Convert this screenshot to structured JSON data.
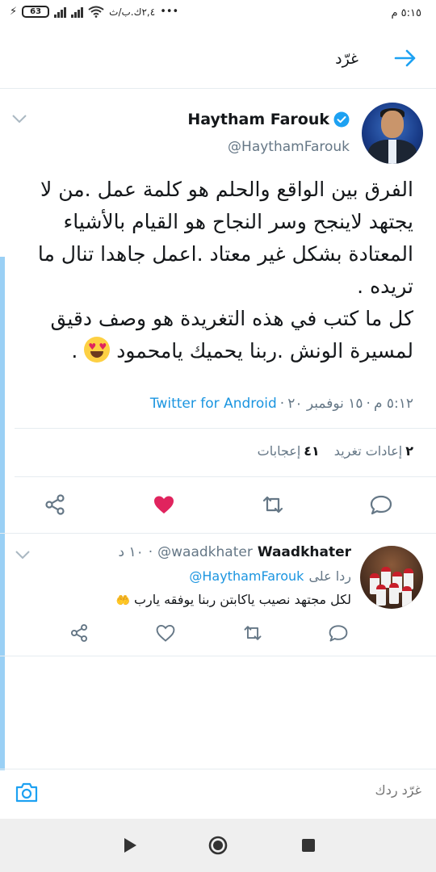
{
  "status_bar": {
    "time": "٥:١٥ م",
    "carrier": "٢,٤ك.ب/ث",
    "battery": "63",
    "dots": "•••"
  },
  "header": {
    "title": "غرّد",
    "back_icon": "arrow-right-icon"
  },
  "tweet": {
    "author_name": "Haytham Farouk",
    "author_handle": "@HaythamFarouk",
    "text": "الفرق بين الواقع والحلم هو كلمة عمل .من لا يجتهد لاينجح وسر النجاح هو القيام بالأشياء المعتادة بشكل غير معتاد .اعمل جاهدا تنال ما تريده .\nكل ما كتب في هذه التغريدة هو وصف دقيق لمسيرة الونش .ربنا يحميك يامحمود",
    "time": "٥:١٢ م",
    "separator": "·",
    "date": "١٥ نوفمبر ٢٠",
    "source": "Twitter for Android",
    "retweets_count": "٢",
    "retweets_label": "إعادات تغريد",
    "likes_count": "٤١",
    "likes_label": "إعجابات",
    "liked": true
  },
  "reply": {
    "name": "Waadkhater",
    "handle": "@waadkhater",
    "time": "١٠ د",
    "replying_to_label": "ردا على",
    "replying_to_handle": "@HaythamFarouk",
    "text": "لكل مجتهد نصيب ياكابتن ربنا يوفقه يارب"
  },
  "composer": {
    "placeholder": "غرّد ردك"
  },
  "colors": {
    "accent": "#1da1f2",
    "like": "#e0245e",
    "thread_line": "#9ad0f5",
    "muted": "#657786"
  }
}
